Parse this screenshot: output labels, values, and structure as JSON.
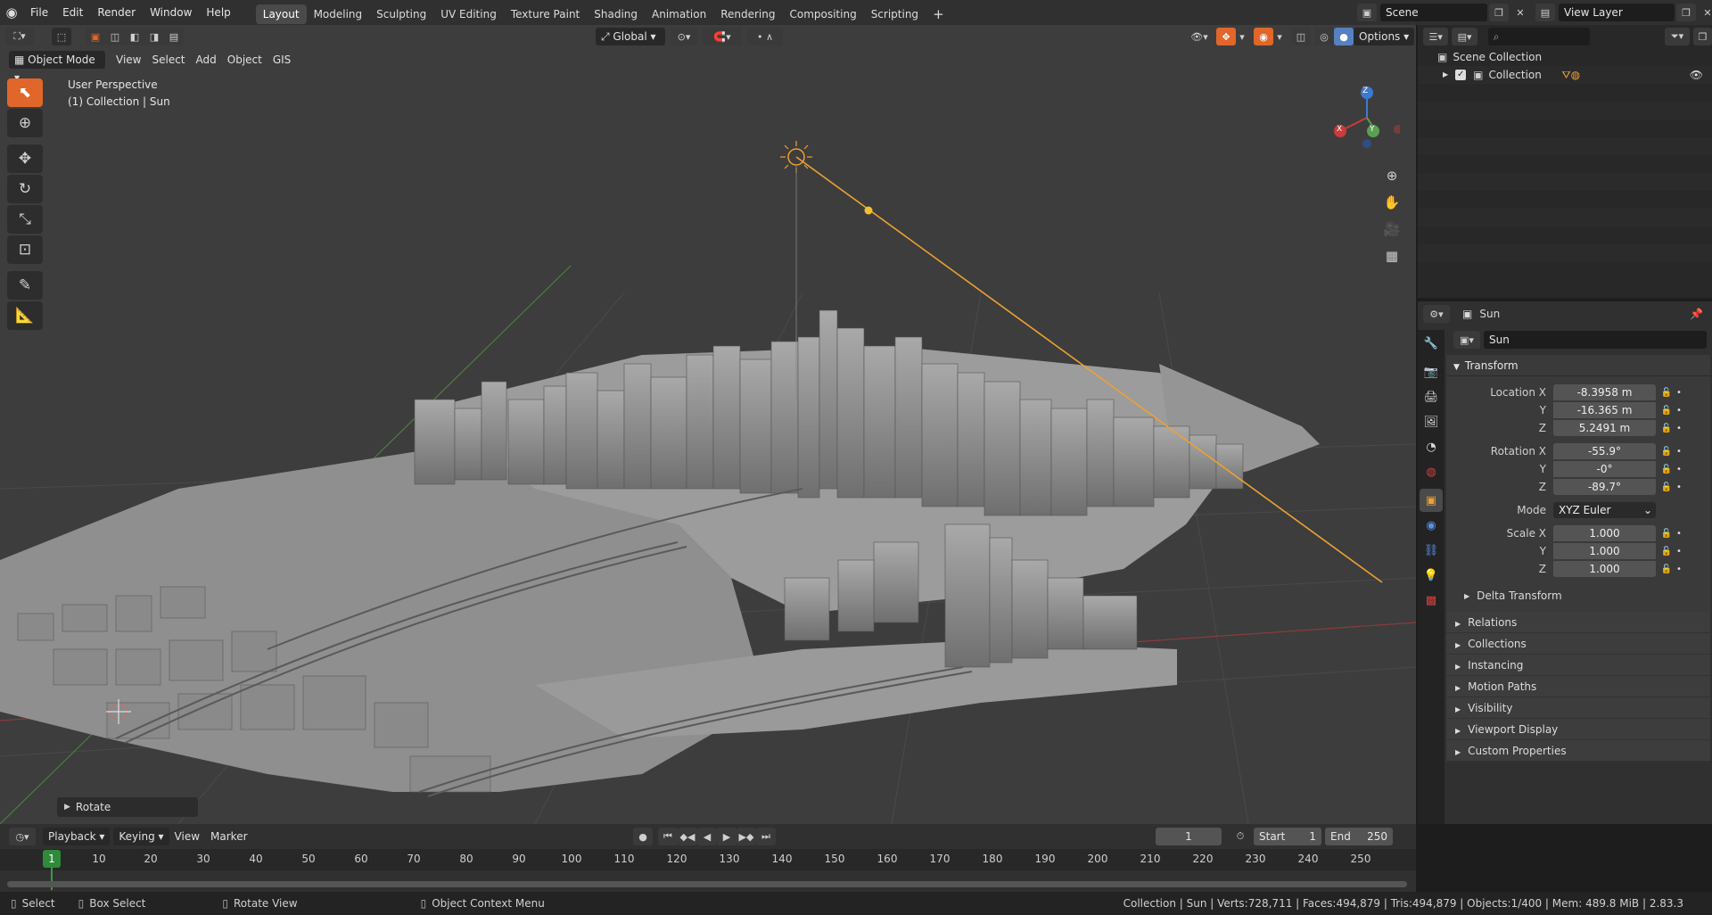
{
  "topbar": {
    "menus": [
      "File",
      "Edit",
      "Render",
      "Window",
      "Help"
    ],
    "workspaces": [
      "Layout",
      "Modeling",
      "Sculpting",
      "UV Editing",
      "Texture Paint",
      "Shading",
      "Animation",
      "Rendering",
      "Compositing",
      "Scripting"
    ],
    "active_workspace": "Layout",
    "add_tab": "+",
    "scene": "Scene",
    "view_layer": "View Layer"
  },
  "viewport_header": {
    "mode": "Object Mode",
    "menus": [
      "View",
      "Select",
      "Add",
      "Object",
      "GIS"
    ],
    "transform_orientation": "Global",
    "options": "Options"
  },
  "viewport": {
    "overlay_line1": "User Perspective",
    "overlay_line2": "(1) Collection | Sun",
    "last_operator": "Rotate",
    "gizmo": {
      "z": "Z",
      "x": "X",
      "y": "Y"
    }
  },
  "outliner": {
    "search_placeholder": "",
    "root": "Scene Collection",
    "items": [
      {
        "label": "Collection"
      }
    ]
  },
  "properties": {
    "object_name_header": "Sun",
    "object_name": "Sun",
    "panel": "Transform",
    "location": {
      "label_x": "Location X",
      "x": "-8.3958 m",
      "y": "-16.365 m",
      "z": "5.2491 m"
    },
    "rotation": {
      "label_x": "Rotation X",
      "x": "-55.9°",
      "y": "-0°",
      "z": "-89.7°"
    },
    "mode_label": "Mode",
    "mode_value": "XYZ Euler",
    "scale": {
      "label_x": "Scale X",
      "x": "1.000",
      "y": "1.000",
      "z": "1.000"
    },
    "axis_y": "Y",
    "axis_z": "Z",
    "delta": "Delta Transform",
    "subpanels": [
      "Relations",
      "Collections",
      "Instancing",
      "Motion Paths",
      "Visibility",
      "Viewport Display",
      "Custom Properties"
    ]
  },
  "timeline": {
    "menus": [
      "Playback",
      "Keying",
      "View",
      "Marker"
    ],
    "current_frame": "1",
    "start_label": "Start",
    "start": "1",
    "end_label": "End",
    "end": "250",
    "ticks": [
      "1",
      "10",
      "20",
      "30",
      "40",
      "50",
      "60",
      "70",
      "80",
      "90",
      "100",
      "110",
      "120",
      "130",
      "140",
      "150",
      "160",
      "170",
      "180",
      "190",
      "200",
      "210",
      "220",
      "230",
      "240",
      "250"
    ]
  },
  "status": {
    "select": "Select",
    "box_select": "Box Select",
    "rotate_view": "Rotate View",
    "context_menu": "Object Context Menu",
    "stats": "Collection | Sun | Verts:728,711 | Faces:494,879 | Tris:494,879 | Objects:1/400 | Mem: 489.8 MiB | 2.83.3"
  },
  "colors": {
    "accent": "#e0662a",
    "sun": "#f0a030",
    "x_axis": "#c83c3c",
    "y_axis": "#5aa050",
    "z_axis": "#3c7ad2"
  }
}
